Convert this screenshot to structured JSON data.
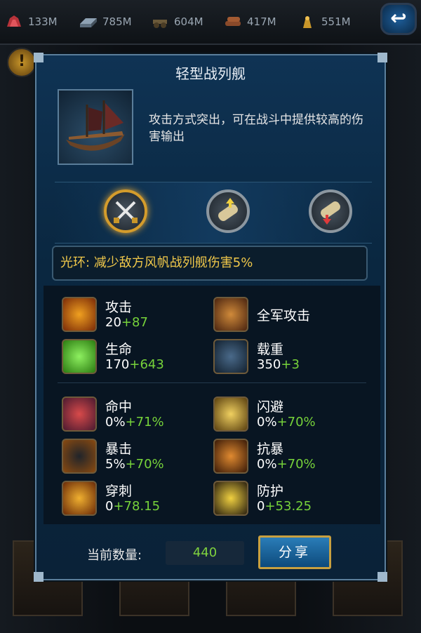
{
  "resources": [
    {
      "icon": "ruby-ore-icon",
      "value": "133M"
    },
    {
      "icon": "iron-ingot-icon",
      "value": "785M"
    },
    {
      "icon": "cannon-icon",
      "value": "604M"
    },
    {
      "icon": "wood-logs-icon",
      "value": "417M"
    },
    {
      "icon": "gold-coins-icon",
      "value": "551M"
    }
  ],
  "back_button": {
    "icon": "back-arrow-icon",
    "label": "↩"
  },
  "panel": {
    "title": "轻型战列舰",
    "description": "攻击方式突出，可在战斗中提供较高的伤害输出",
    "aura": "光环: 减少敌方风帆战列舰伤害5%",
    "tabs": [
      {
        "icon": "crossed-swords-icon",
        "active": true
      },
      {
        "icon": "scroll-up-icon",
        "active": false
      },
      {
        "icon": "scroll-down-icon",
        "active": false
      }
    ]
  },
  "stats": {
    "attack": {
      "label": "攻击",
      "base": "20",
      "bonus": "+87"
    },
    "army_attack": {
      "label": "全军攻击"
    },
    "life": {
      "label": "生命",
      "base": "170",
      "bonus": "+643"
    },
    "load": {
      "label": "载重",
      "base": "350",
      "bonus": "+3"
    },
    "hit": {
      "label": "命中",
      "base": "0%",
      "bonus": "+71%"
    },
    "dodge": {
      "label": "闪避",
      "base": "0%",
      "bonus": "+70%"
    },
    "crit": {
      "label": "暴击",
      "base": "5%",
      "bonus": "+70%"
    },
    "anti_crit": {
      "label": "抗暴",
      "base": "0%",
      "bonus": "+70%"
    },
    "pierce": {
      "label": "穿刺",
      "base": "0",
      "bonus": "+78.15"
    },
    "defense": {
      "label": "防护",
      "base": "0",
      "bonus": "+53.25"
    }
  },
  "footer": {
    "count_label": "当前数量:",
    "count_value": "440",
    "share_label": "分享"
  }
}
